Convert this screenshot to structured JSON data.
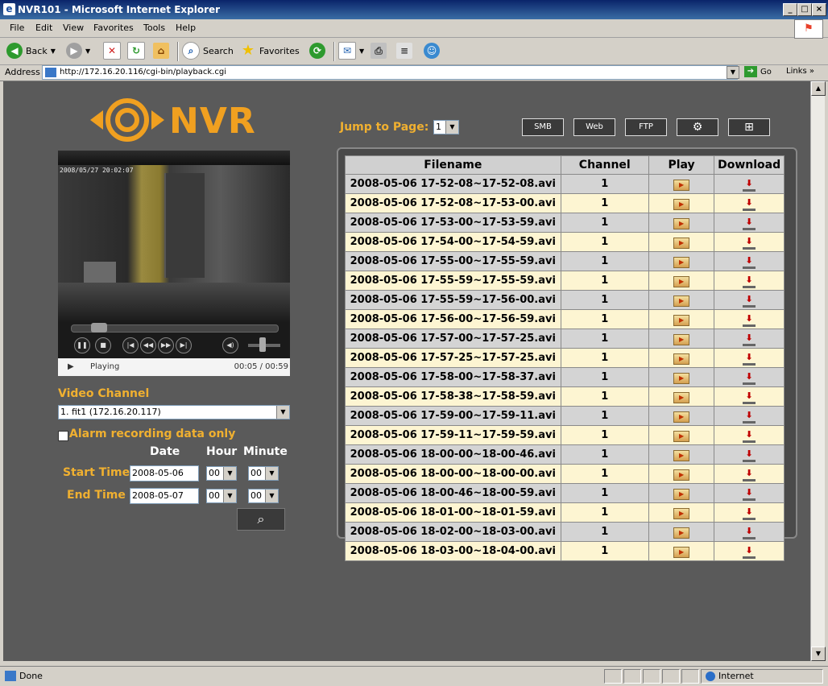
{
  "window": {
    "title": "NVR101 - Microsoft Internet Explorer"
  },
  "menu": [
    "File",
    "Edit",
    "View",
    "Favorites",
    "Tools",
    "Help"
  ],
  "toolbar": {
    "back": "Back",
    "search": "Search",
    "favorites": "Favorites"
  },
  "address": {
    "label": "Address",
    "url": "http://172.16.20.116/cgi-bin/playback.cgi",
    "go": "Go",
    "links": "Links"
  },
  "status": {
    "text": "Done",
    "zone": "Internet"
  },
  "nvr": {
    "logo": "NVR",
    "jump_label": "Jump to Page:",
    "page_value": "1",
    "icons": [
      "SMB",
      "Web",
      "FTP"
    ],
    "player": {
      "timestamp": "2008/05/27 20:02:07",
      "state": "Playing",
      "time": "00:05 / 00:59",
      "progress": 0.1
    },
    "video_channel_label": "Video Channel",
    "video_channel_value": "1. fit1 (172.16.20.117)",
    "alarm_label": "Alarm recording data only",
    "headers": {
      "date": "Date",
      "hour": "Hour",
      "minute": "Minute"
    },
    "start": {
      "label": "Start Time",
      "date": "2008-05-06",
      "hour": "00",
      "minute": "00"
    },
    "end": {
      "label": "End Time",
      "date": "2008-05-07",
      "hour": "00",
      "minute": "00"
    },
    "table": {
      "columns": [
        "Filename",
        "Channel",
        "Play",
        "Download"
      ],
      "rows": [
        {
          "filename": "2008-05-06 17-52-08~17-52-08.avi",
          "channel": "1"
        },
        {
          "filename": "2008-05-06 17-52-08~17-53-00.avi",
          "channel": "1"
        },
        {
          "filename": "2008-05-06 17-53-00~17-53-59.avi",
          "channel": "1"
        },
        {
          "filename": "2008-05-06 17-54-00~17-54-59.avi",
          "channel": "1"
        },
        {
          "filename": "2008-05-06 17-55-00~17-55-59.avi",
          "channel": "1"
        },
        {
          "filename": "2008-05-06 17-55-59~17-55-59.avi",
          "channel": "1"
        },
        {
          "filename": "2008-05-06 17-55-59~17-56-00.avi",
          "channel": "1"
        },
        {
          "filename": "2008-05-06 17-56-00~17-56-59.avi",
          "channel": "1"
        },
        {
          "filename": "2008-05-06 17-57-00~17-57-25.avi",
          "channel": "1"
        },
        {
          "filename": "2008-05-06 17-57-25~17-57-25.avi",
          "channel": "1"
        },
        {
          "filename": "2008-05-06 17-58-00~17-58-37.avi",
          "channel": "1"
        },
        {
          "filename": "2008-05-06 17-58-38~17-58-59.avi",
          "channel": "1"
        },
        {
          "filename": "2008-05-06 17-59-00~17-59-11.avi",
          "channel": "1"
        },
        {
          "filename": "2008-05-06 17-59-11~17-59-59.avi",
          "channel": "1"
        },
        {
          "filename": "2008-05-06 18-00-00~18-00-46.avi",
          "channel": "1"
        },
        {
          "filename": "2008-05-06 18-00-00~18-00-00.avi",
          "channel": "1"
        },
        {
          "filename": "2008-05-06 18-00-46~18-00-59.avi",
          "channel": "1"
        },
        {
          "filename": "2008-05-06 18-01-00~18-01-59.avi",
          "channel": "1"
        },
        {
          "filename": "2008-05-06 18-02-00~18-03-00.avi",
          "channel": "1"
        },
        {
          "filename": "2008-05-06 18-03-00~18-04-00.avi",
          "channel": "1"
        }
      ]
    }
  }
}
